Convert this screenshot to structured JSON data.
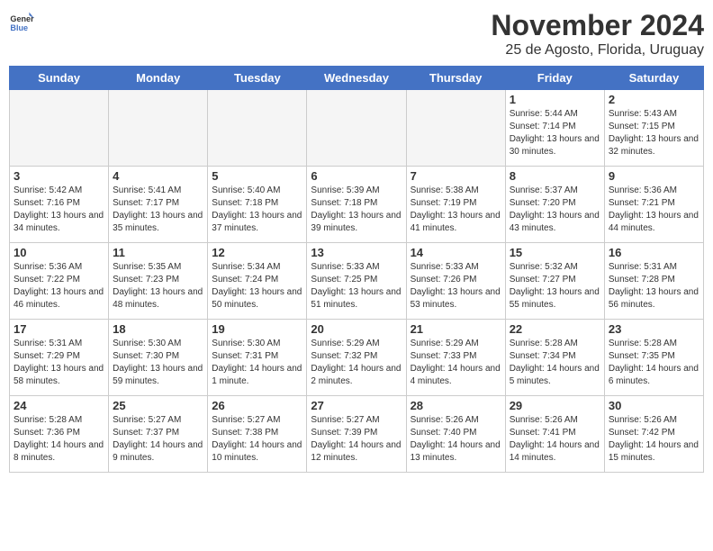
{
  "header": {
    "logo_general": "General",
    "logo_blue": "Blue",
    "title": "November 2024",
    "subtitle": "25 de Agosto, Florida, Uruguay"
  },
  "columns": [
    "Sunday",
    "Monday",
    "Tuesday",
    "Wednesday",
    "Thursday",
    "Friday",
    "Saturday"
  ],
  "weeks": [
    [
      {
        "day": "",
        "info": ""
      },
      {
        "day": "",
        "info": ""
      },
      {
        "day": "",
        "info": ""
      },
      {
        "day": "",
        "info": ""
      },
      {
        "day": "",
        "info": ""
      },
      {
        "day": "1",
        "info": "Sunrise: 5:44 AM\nSunset: 7:14 PM\nDaylight: 13 hours and 30 minutes."
      },
      {
        "day": "2",
        "info": "Sunrise: 5:43 AM\nSunset: 7:15 PM\nDaylight: 13 hours and 32 minutes."
      }
    ],
    [
      {
        "day": "3",
        "info": "Sunrise: 5:42 AM\nSunset: 7:16 PM\nDaylight: 13 hours and 34 minutes."
      },
      {
        "day": "4",
        "info": "Sunrise: 5:41 AM\nSunset: 7:17 PM\nDaylight: 13 hours and 35 minutes."
      },
      {
        "day": "5",
        "info": "Sunrise: 5:40 AM\nSunset: 7:18 PM\nDaylight: 13 hours and 37 minutes."
      },
      {
        "day": "6",
        "info": "Sunrise: 5:39 AM\nSunset: 7:18 PM\nDaylight: 13 hours and 39 minutes."
      },
      {
        "day": "7",
        "info": "Sunrise: 5:38 AM\nSunset: 7:19 PM\nDaylight: 13 hours and 41 minutes."
      },
      {
        "day": "8",
        "info": "Sunrise: 5:37 AM\nSunset: 7:20 PM\nDaylight: 13 hours and 43 minutes."
      },
      {
        "day": "9",
        "info": "Sunrise: 5:36 AM\nSunset: 7:21 PM\nDaylight: 13 hours and 44 minutes."
      }
    ],
    [
      {
        "day": "10",
        "info": "Sunrise: 5:36 AM\nSunset: 7:22 PM\nDaylight: 13 hours and 46 minutes."
      },
      {
        "day": "11",
        "info": "Sunrise: 5:35 AM\nSunset: 7:23 PM\nDaylight: 13 hours and 48 minutes."
      },
      {
        "day": "12",
        "info": "Sunrise: 5:34 AM\nSunset: 7:24 PM\nDaylight: 13 hours and 50 minutes."
      },
      {
        "day": "13",
        "info": "Sunrise: 5:33 AM\nSunset: 7:25 PM\nDaylight: 13 hours and 51 minutes."
      },
      {
        "day": "14",
        "info": "Sunrise: 5:33 AM\nSunset: 7:26 PM\nDaylight: 13 hours and 53 minutes."
      },
      {
        "day": "15",
        "info": "Sunrise: 5:32 AM\nSunset: 7:27 PM\nDaylight: 13 hours and 55 minutes."
      },
      {
        "day": "16",
        "info": "Sunrise: 5:31 AM\nSunset: 7:28 PM\nDaylight: 13 hours and 56 minutes."
      }
    ],
    [
      {
        "day": "17",
        "info": "Sunrise: 5:31 AM\nSunset: 7:29 PM\nDaylight: 13 hours and 58 minutes."
      },
      {
        "day": "18",
        "info": "Sunrise: 5:30 AM\nSunset: 7:30 PM\nDaylight: 13 hours and 59 minutes."
      },
      {
        "day": "19",
        "info": "Sunrise: 5:30 AM\nSunset: 7:31 PM\nDaylight: 14 hours and 1 minute."
      },
      {
        "day": "20",
        "info": "Sunrise: 5:29 AM\nSunset: 7:32 PM\nDaylight: 14 hours and 2 minutes."
      },
      {
        "day": "21",
        "info": "Sunrise: 5:29 AM\nSunset: 7:33 PM\nDaylight: 14 hours and 4 minutes."
      },
      {
        "day": "22",
        "info": "Sunrise: 5:28 AM\nSunset: 7:34 PM\nDaylight: 14 hours and 5 minutes."
      },
      {
        "day": "23",
        "info": "Sunrise: 5:28 AM\nSunset: 7:35 PM\nDaylight: 14 hours and 6 minutes."
      }
    ],
    [
      {
        "day": "24",
        "info": "Sunrise: 5:28 AM\nSunset: 7:36 PM\nDaylight: 14 hours and 8 minutes."
      },
      {
        "day": "25",
        "info": "Sunrise: 5:27 AM\nSunset: 7:37 PM\nDaylight: 14 hours and 9 minutes."
      },
      {
        "day": "26",
        "info": "Sunrise: 5:27 AM\nSunset: 7:38 PM\nDaylight: 14 hours and 10 minutes."
      },
      {
        "day": "27",
        "info": "Sunrise: 5:27 AM\nSunset: 7:39 PM\nDaylight: 14 hours and 12 minutes."
      },
      {
        "day": "28",
        "info": "Sunrise: 5:26 AM\nSunset: 7:40 PM\nDaylight: 14 hours and 13 minutes."
      },
      {
        "day": "29",
        "info": "Sunrise: 5:26 AM\nSunset: 7:41 PM\nDaylight: 14 hours and 14 minutes."
      },
      {
        "day": "30",
        "info": "Sunrise: 5:26 AM\nSunset: 7:42 PM\nDaylight: 14 hours and 15 minutes."
      }
    ]
  ]
}
